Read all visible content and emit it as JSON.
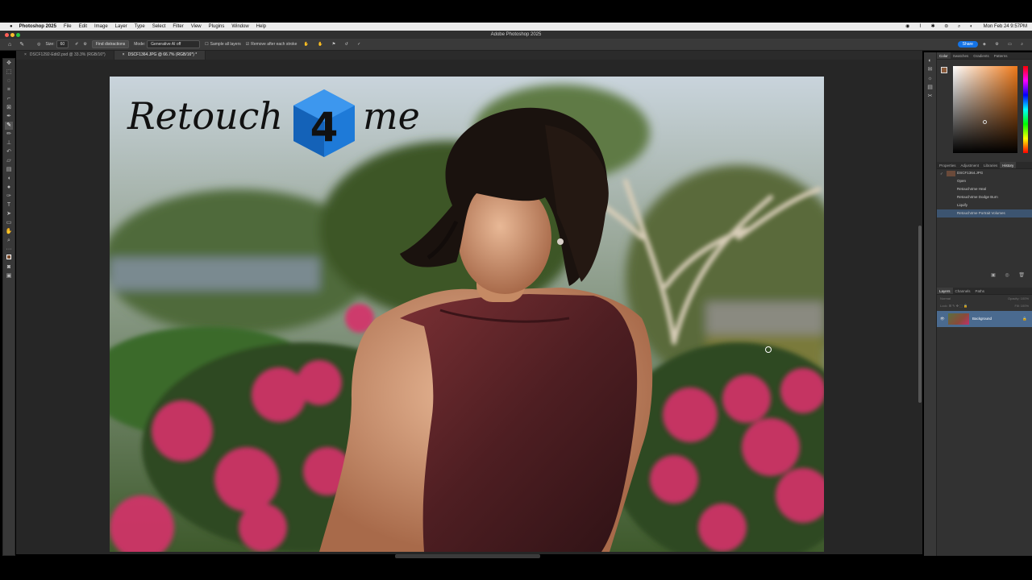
{
  "menubar": {
    "app": "Photoshop 2025",
    "items": [
      "File",
      "Edit",
      "Image",
      "Layer",
      "Type",
      "Select",
      "Filter",
      "View",
      "Plugins",
      "Window",
      "Help"
    ],
    "clock": "Mon Feb 24  9:57PM"
  },
  "window": {
    "title": "Adobe Photoshop 2025"
  },
  "options": {
    "size_label": "Size:",
    "size_value": "60",
    "find_btn": "Find distractions",
    "mode_label": "Mode:",
    "mode_value": "Generative AI off",
    "sample_all": "Sample all layers",
    "remove_after": "Remove after each stroke",
    "share": "Share"
  },
  "tabs": [
    "DSCF1292-Edit2.psd @ 33.3% (RGB/16*)",
    "DSCF1364.JPG @ 66.7% (RGB/16*) *"
  ],
  "logo": {
    "text_left": "Retouch",
    "text_right": "me",
    "cube_glyph": "4"
  },
  "color_panel": {
    "tabs": [
      "Color",
      "Swatches",
      "Gradients",
      "Patterns"
    ]
  },
  "history_panel": {
    "tabs": [
      "Properties",
      "Adjustment",
      "Libraries",
      "History"
    ],
    "snapshot": "DSCF1364.JPG",
    "states": [
      "Open",
      "Retouch4me Heal",
      "Retouch4me Dodge Burn",
      "Liquify",
      "Retouch4me Portrait Volumes"
    ]
  },
  "layers_panel": {
    "tabs": [
      "Layers",
      "Channels",
      "Paths"
    ],
    "kind": "Normal",
    "opacity": "Opacity: 100%",
    "lock": "Lock:",
    "fill": "Fill: 100%",
    "layer_name": "Background"
  },
  "colors": {
    "accent": "#1473e6",
    "history_sel": "#3c5470",
    "layer_sel": "#4a6a8f"
  }
}
